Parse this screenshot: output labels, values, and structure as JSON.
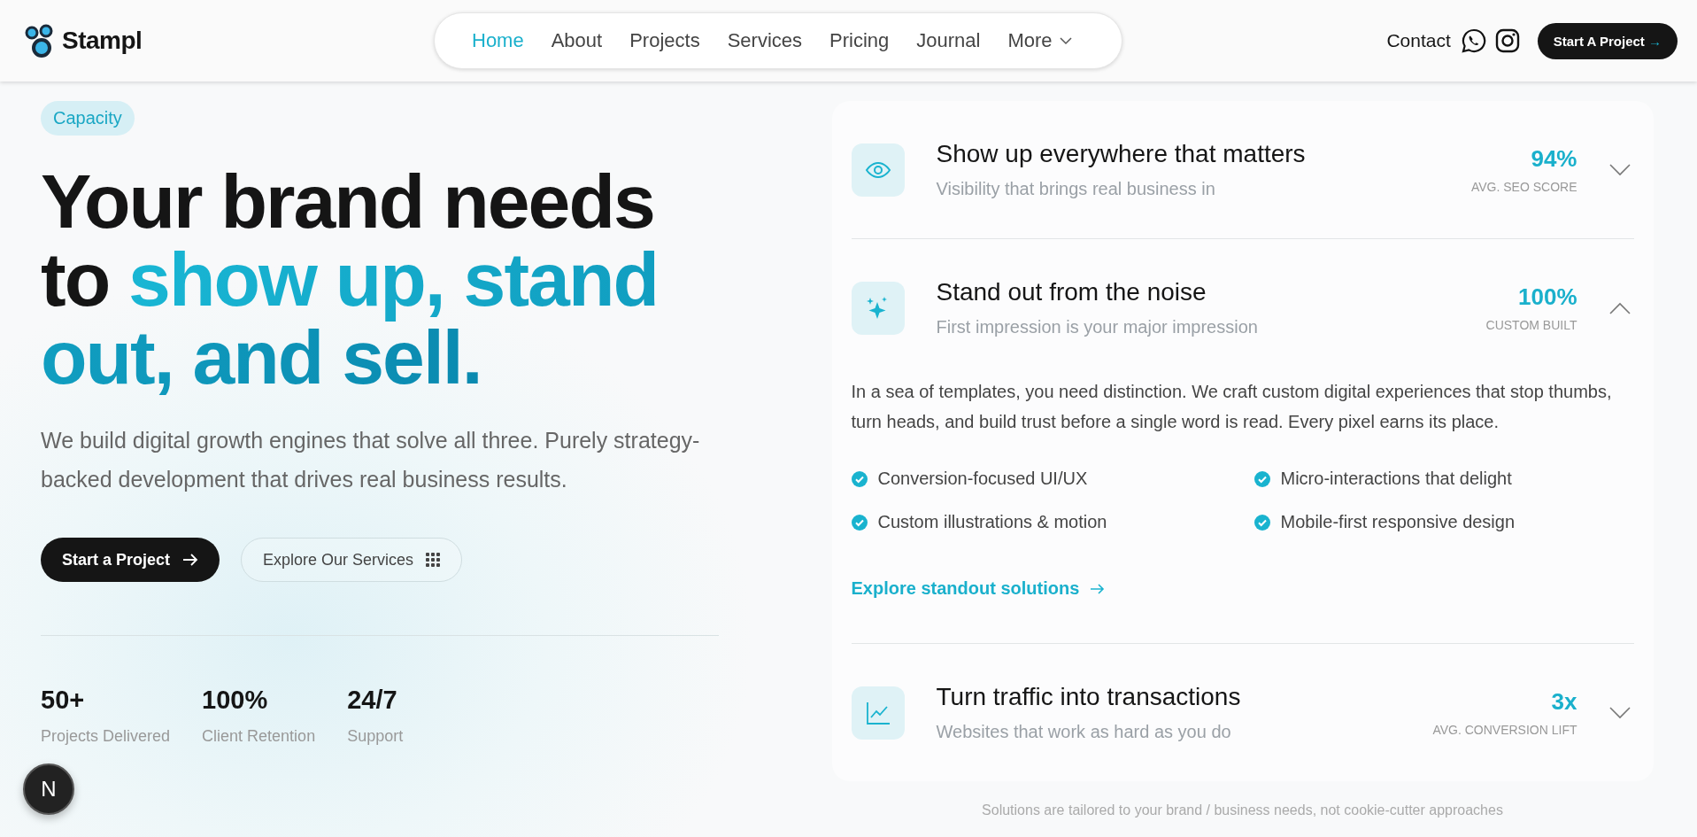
{
  "header": {
    "logo": "Stampl",
    "nav": [
      {
        "label": "Home",
        "selected": true
      },
      {
        "label": "About",
        "selected": false
      },
      {
        "label": "Projects",
        "selected": false
      },
      {
        "label": "Services",
        "selected": false
      },
      {
        "label": "Pricing",
        "selected": false
      },
      {
        "label": "Journal",
        "selected": false
      },
      {
        "label": "More",
        "selected": false,
        "kind": "dropdown"
      }
    ],
    "contact": "Contact",
    "cta": "Start A Project",
    "cta_arrow": "→"
  },
  "hero": {
    "badge": "Capacity",
    "headline_dark": "Your brand needs to",
    "headline_accent": "show up, stand out, and sell.",
    "paragraph": "We build digital growth engines that solve all three. Purely strategy-backed development that drives real business results.",
    "buttons": [
      {
        "label": "Start a Project",
        "kind": "primary"
      },
      {
        "label": "Explore Our Services",
        "kind": "secondary"
      }
    ],
    "stats": [
      {
        "value": "50+",
        "label": "Projects Delivered"
      },
      {
        "value": "100%",
        "label": "Client Retention"
      },
      {
        "value": "24/7",
        "label": "Support"
      }
    ]
  },
  "dev_badge": "N",
  "accordion": [
    {
      "kind": "eye",
      "title": "Show up everywhere that matters",
      "subtitle": "Visibility that brings real business in",
      "metric": "94%",
      "metric_label": "AVG. SEO SCORE",
      "expanded": false
    },
    {
      "kind": "sparkles",
      "title": "Stand out from the noise",
      "subtitle": "First impression is your major impression",
      "metric": "100%",
      "metric_label": "CUSTOM BUILT",
      "expanded": true,
      "body": "In a sea of templates, you need distinction. We craft custom digital experiences that stop thumbs, turn heads, and build trust before a single word is read. Every pixel earns its place.",
      "features": [
        "Conversion-focused UI/UX",
        "Micro-interactions that delight",
        "Custom illustrations & motion",
        "Mobile-first responsive design"
      ],
      "link": "Explore standout solutions"
    },
    {
      "kind": "chart",
      "title": "Turn traffic into transactions",
      "subtitle": "Websites that work as hard as you do",
      "metric": "3x",
      "metric_label": "AVG. CONVERSION LIFT",
      "expanded": false
    }
  ],
  "footnote": "Solutions are tailored to your brand / business needs, not cookie-cutter approaches"
}
